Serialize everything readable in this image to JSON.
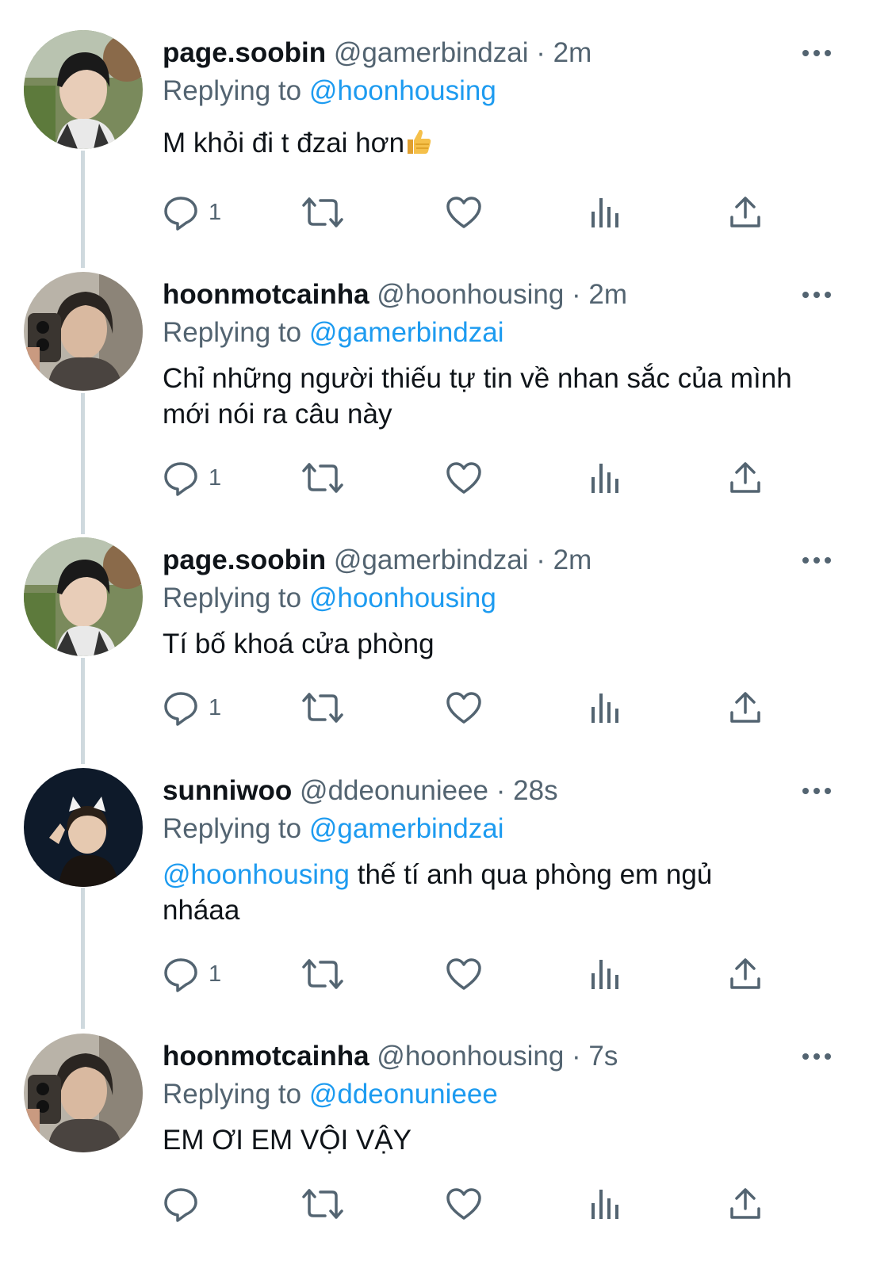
{
  "colors": {
    "text": "#0f1419",
    "secondary": "#536471",
    "link": "#1d9bf0",
    "thread_line": "#cfd9de"
  },
  "icons": {
    "reply": "reply-icon",
    "retweet": "retweet-icon",
    "like": "heart-icon",
    "views": "views-icon",
    "share": "share-icon",
    "more": "more-icon"
  },
  "tweets": [
    {
      "display_name": "page.soobin",
      "handle": "@gamerbindzai",
      "separator": "·",
      "time": "2m",
      "replying_prefix": "Replying to",
      "replying_to": "@hoonhousing",
      "text": "M khỏi đi t đzai hơn",
      "emoji": "👍",
      "reply_count": "1"
    },
    {
      "display_name": "hoonmotcainha",
      "handle": "@hoonhousing",
      "separator": "·",
      "time": "2m",
      "replying_prefix": "Replying to",
      "replying_to": "@gamerbindzai",
      "text_line1": "Chỉ những người thiếu tự tin về nhan sắc của mình",
      "text_line2": "mới nói ra câu này",
      "reply_count": "1"
    },
    {
      "display_name": "page.soobin",
      "handle": "@gamerbindzai",
      "separator": "·",
      "time": "2m",
      "replying_prefix": "Replying to",
      "replying_to": "@hoonhousing",
      "text": "Tí bố khoá cửa phòng",
      "reply_count": "1"
    },
    {
      "display_name": "sunniwoo",
      "handle": "@ddeonunieee",
      "separator": "·",
      "time": "28s",
      "replying_prefix": "Replying to",
      "replying_to": "@gamerbindzai",
      "text_mention": "@hoonhousing",
      "text_line1": " thế tí anh qua phòng em ngủ",
      "text_line2": "nháaa",
      "reply_count": "1"
    },
    {
      "display_name": "hoonmotcainha",
      "handle": "@hoonhousing",
      "separator": "·",
      "time": "7s",
      "replying_prefix": "Replying to",
      "replying_to": "@ddeonunieee",
      "text": "EM ƠI EM VỘI VẬY",
      "reply_count": ""
    }
  ]
}
